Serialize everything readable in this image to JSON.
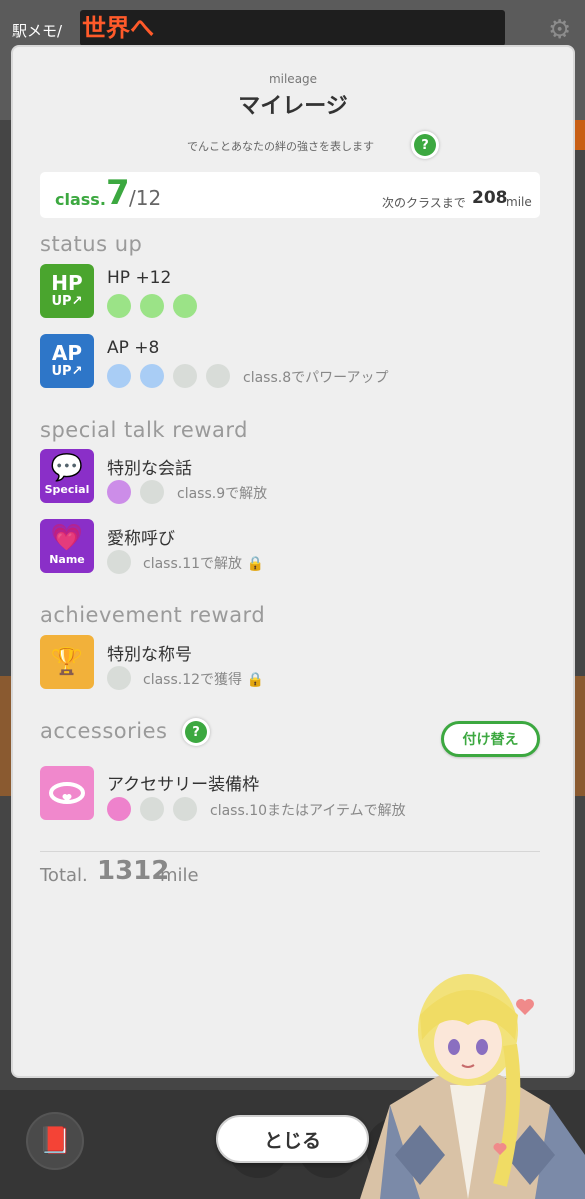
{
  "background": {
    "app_title": "駅メモ/",
    "banner": "世界へ"
  },
  "modal": {
    "subtitle": "mileage",
    "title": "マイレージ",
    "description": "でんことあなたの絆の強さを表します",
    "help_icon": "?",
    "class": {
      "label": "class.",
      "current": "7",
      "max": "/12",
      "next_label": "次のクラスまで",
      "next_value": "208",
      "next_unit": "mile"
    },
    "status_up": {
      "heading": "status up",
      "hp": {
        "icon_top": "HP",
        "icon_bottom": "UP",
        "name": "HP +12",
        "filled": 3,
        "total": 3,
        "note": ""
      },
      "ap": {
        "icon_top": "AP",
        "icon_bottom": "UP",
        "name": "AP +8",
        "filled": 2,
        "total": 4,
        "note": "class.8でパワーアップ"
      }
    },
    "special_talk_reward": {
      "heading": "special talk reward",
      "talk": {
        "icon_label": "Special",
        "name": "特別な会話",
        "filled": 1,
        "total": 2,
        "note": "class.9で解放"
      },
      "nickname": {
        "icon_label": "Name",
        "name": "愛称呼び",
        "filled": 0,
        "total": 1,
        "note": "class.11で解放"
      }
    },
    "achievement_reward": {
      "heading": "achievement reward",
      "title_item": {
        "name": "特別な称号",
        "filled": 0,
        "total": 1,
        "note": "class.12で獲得"
      }
    },
    "accessories": {
      "heading": "accessories",
      "swap_button": "付け替え",
      "slot": {
        "name": "アクセサリー装備枠",
        "filled": 1,
        "total": 3,
        "note": "class.10またはアイテムで解放"
      }
    },
    "total": {
      "label": "Total.",
      "value": "1312",
      "unit": "mile"
    },
    "close_button": "とじる"
  },
  "colors": {
    "accent_green": "#3ca840",
    "hp_green": "#4aa52e",
    "ap_blue": "#2e76c8",
    "talk_purple": "#8a2fc8",
    "achievement_gold": "#f2b13a",
    "accessory_pink": "#f088cc"
  }
}
